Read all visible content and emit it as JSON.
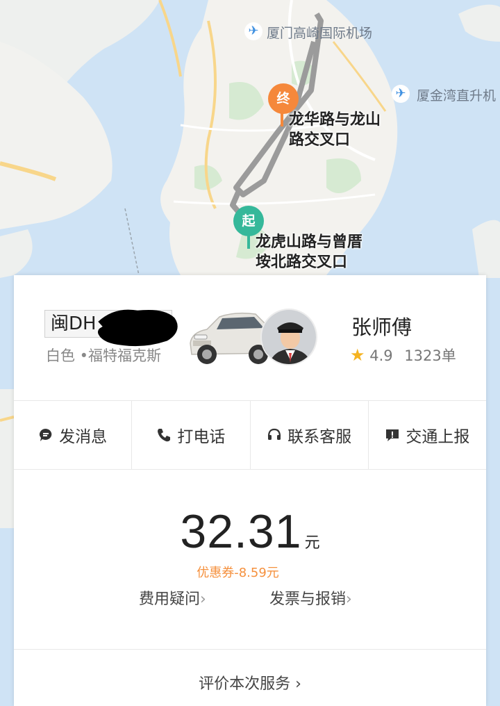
{
  "map": {
    "labels": {
      "airport_main": "厦门高崎国际机场",
      "airport_heli": "厦金湾直升机"
    },
    "destination": {
      "pin": "终",
      "name_line1": "龙华路与龙山",
      "name_line2": "路交叉口"
    },
    "origin": {
      "pin": "起",
      "name_line1": "龙虎山路与曾厝",
      "name_line2": "垵北路交叉口"
    },
    "colors": {
      "origin": "#35b89a",
      "destination": "#f5883b",
      "route": "#9b9b9b"
    }
  },
  "driver": {
    "plate": "闽DH",
    "car_desc": "白色 •福特福克斯",
    "name": "张师傅",
    "rating": "4.9",
    "orders": "1323单"
  },
  "actions": [
    {
      "label": "发消息",
      "icon": "message-icon"
    },
    {
      "label": "打电话",
      "icon": "phone-icon"
    },
    {
      "label": "联系客服",
      "icon": "headset-icon"
    },
    {
      "label": "交通上报",
      "icon": "report-icon"
    }
  ],
  "fare": {
    "amount": "32.31",
    "unit": "元",
    "coupon": "优惠券-8.59元",
    "question": "费用疑问",
    "invoice": "发票与报销"
  },
  "rate_service": "评价本次服务 ›"
}
